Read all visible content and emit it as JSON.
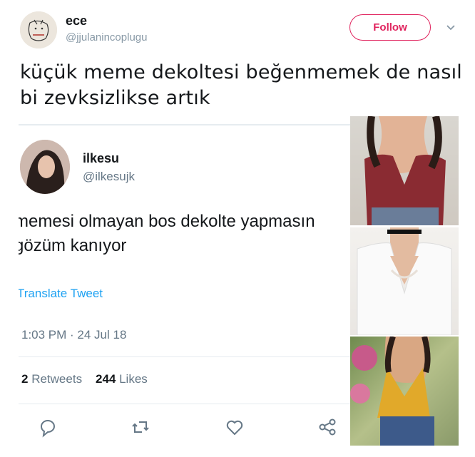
{
  "tweet": {
    "display_name": "ece",
    "handle": "@jjulanincoplugu",
    "follow_label": "Follow",
    "text_line1": "küçük meme dekoltesi beğenmemek de nasıl",
    "text_line2": "bi zevksizlikse artık"
  },
  "quoted": {
    "display_name": "ilkesu",
    "handle": "@ilkesujk",
    "text_line1": "memesi olmayan bos dekolte yapmasın",
    "text_line2": "gözüm kanıyor",
    "translate_label": "Translate Tweet",
    "timestamp": "1:03 PM · 24 Jul 18",
    "retweets_count": "2",
    "retweets_label": "Retweets",
    "likes_count": "244",
    "likes_label": "Likes"
  },
  "icons": [
    "chevron-down-icon",
    "reply-icon",
    "retweet-icon",
    "like-icon",
    "share-icon"
  ],
  "colors": {
    "accent": "#e0245e",
    "link": "#1da1f2",
    "muted": "#657786"
  }
}
